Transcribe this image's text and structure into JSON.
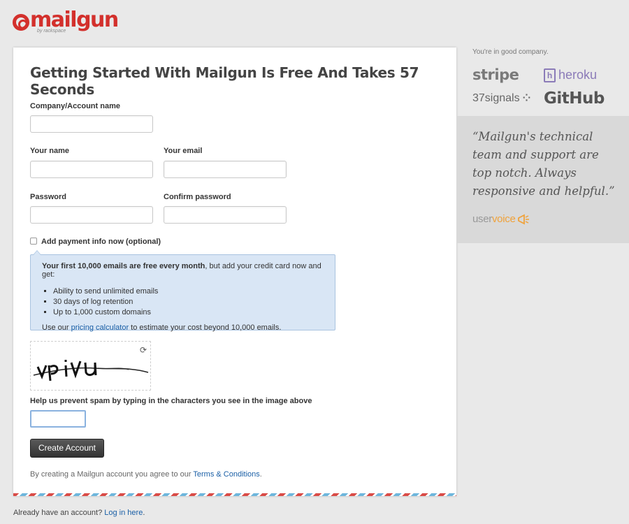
{
  "brand": {
    "name": "mailgun",
    "sub": "by rackspace"
  },
  "form": {
    "title": "Getting Started With Mailgun Is Free And Takes 57 Seconds",
    "company_label": "Company/Account name",
    "company_value": "",
    "name_label": "Your name",
    "name_value": "",
    "email_label": "Your email",
    "email_value": "",
    "password_label": "Password",
    "confirm_label": "Confirm password",
    "payment_label": "Add payment info now (optional)",
    "payment_checked": false,
    "info": {
      "lead_bold": "Your first 10,000 emails are free every month",
      "lead_rest": ", but add your credit card now and get:",
      "items": [
        "Ability to send unlimited emails",
        "30 days of log retention",
        "Up to 1,000 custom domains"
      ],
      "calc_prefix": "Use our ",
      "calc_link": "pricing calculator",
      "calc_suffix": " to estimate your cost beyond 10,000 emails."
    },
    "captcha_text": "vpivu",
    "captcha_refresh_icon": "refresh-icon",
    "captcha_label": "Help us prevent spam by typing in the characters you see in the image above",
    "captcha_value": "",
    "submit_label": "Create Account",
    "terms_prefix": "By creating a Mailgun account you agree to our ",
    "terms_link": "Terms & Conditions",
    "terms_suffix": "."
  },
  "footer": {
    "prefix": "Already have an account? ",
    "link": "Log in here",
    "suffix": "."
  },
  "sidebar": {
    "company_note": "You're in good company.",
    "logos": {
      "stripe": "stripe",
      "heroku": "heroku",
      "heroku_mark": "h",
      "signals": "37signals",
      "github": "GitHub"
    },
    "quote": "“Mailgun's technical team and support are top notch. Always responsive and helpful.”",
    "uservoice_user": "user",
    "uservoice_voice": "voice"
  },
  "colors": {
    "brand_red": "#d3302c",
    "link_blue": "#1a5fa6",
    "info_bg": "#d9e6f5",
    "uservoice_orange": "#f0a23a"
  }
}
